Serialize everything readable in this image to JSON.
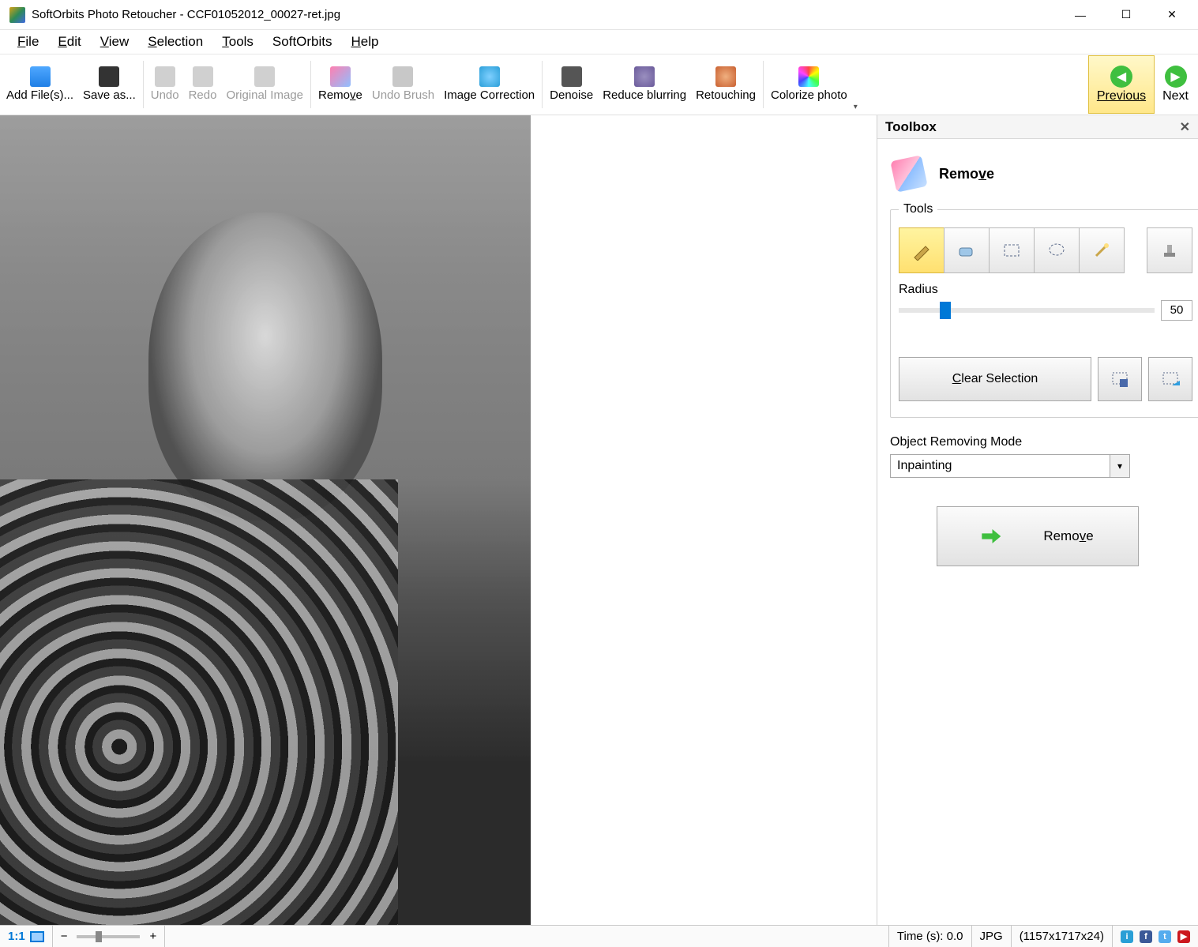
{
  "title": "SoftOrbits Photo Retoucher - CCF01052012_00027-ret.jpg",
  "menu": {
    "file": "File",
    "edit": "Edit",
    "view": "View",
    "selection": "Selection",
    "tools": "Tools",
    "softorbits": "SoftOrbits",
    "help": "Help"
  },
  "toolbar": {
    "add": "Add File(s)...",
    "save": "Save as...",
    "undo": "Undo",
    "redo": "Redo",
    "original": "Original Image",
    "remove": "Remove",
    "undoBrush": "Undo Brush",
    "imgcorr": "Image Correction",
    "denoise": "Denoise",
    "reduce": "Reduce blurring",
    "retouch": "Retouching",
    "colorize": "Colorize photo",
    "previous": "Previous",
    "next": "Next"
  },
  "toolbox": {
    "title": "Toolbox",
    "remove_title": "Remove",
    "tools_legend": "Tools",
    "radius_label": "Radius",
    "radius_value": "50",
    "clear": "Clear Selection",
    "mode_label": "Object Removing Mode",
    "mode_value": "Inpainting",
    "remove_btn": "Remove"
  },
  "status": {
    "zoom": "1:1",
    "time": "Time (s): 0.0",
    "format": "JPG",
    "dim": "(1157x1717x24)"
  }
}
